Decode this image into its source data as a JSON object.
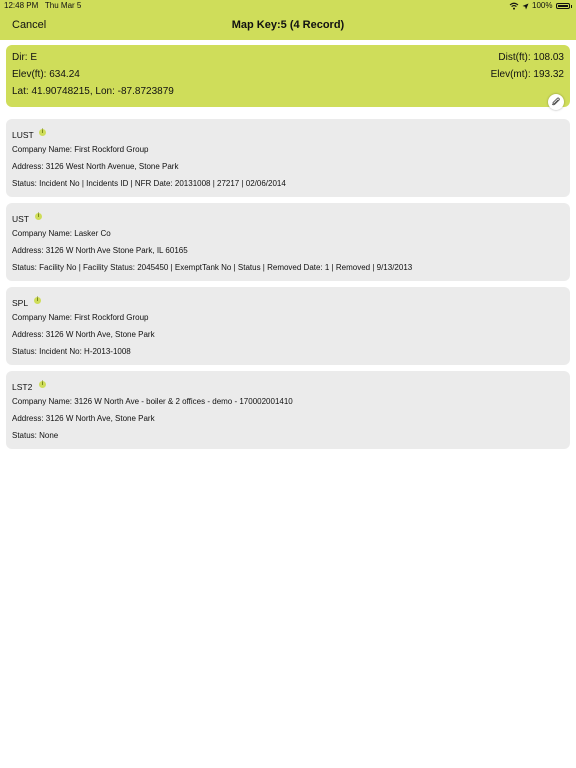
{
  "status_bar": {
    "time": "12:48 PM",
    "date": "Thu Mar 5",
    "battery": "100%"
  },
  "nav": {
    "cancel_label": "Cancel",
    "title": "Map Key:5 (4 Record)"
  },
  "info": {
    "dir": "Dir: E",
    "dist": "Dist(ft): 108.03",
    "elev_ft": "Elev(ft): 634.24",
    "elev_mt": "Elev(mt): 193.32",
    "latlon": "Lat: 41.90748215, Lon: -87.8723879"
  },
  "records": [
    {
      "code": "LUST",
      "company": "Company Name: First Rockford Group",
      "address": "Address: 3126 West North Avenue, Stone Park",
      "status": "Status: Incident No | Incidents ID | NFR Date: 20131008 | 27217 | 02/06/2014"
    },
    {
      "code": "UST",
      "company": "Company Name: Lasker Co",
      "address": "Address: 3126 W North Ave Stone Park, IL 60165",
      "status": "Status: Facility No | Facility Status: 2045450 | ExemptTank No | Status | Removed Date: 1 | Removed | 9/13/2013"
    },
    {
      "code": "SPL",
      "company": "Company Name: First Rockford Group",
      "address": "Address: 3126 W North Ave, Stone Park",
      "status": "Status: Incident No: H-2013-1008"
    },
    {
      "code": "LST2",
      "company": "Company Name: 3126 W North Ave - boiler & 2 offices - demo - 170002001410",
      "address": "Address: 3126 W North Ave, Stone Park",
      "status": "Status: None"
    }
  ],
  "icons": {
    "info_icon_glyph": "i",
    "wifi": "wifi-icon",
    "location": "location-arrow-icon",
    "battery": "battery-icon",
    "attachment": "paperclip-icon"
  },
  "colors": {
    "accent": "#cfdd5a",
    "card": "#ebebeb"
  }
}
